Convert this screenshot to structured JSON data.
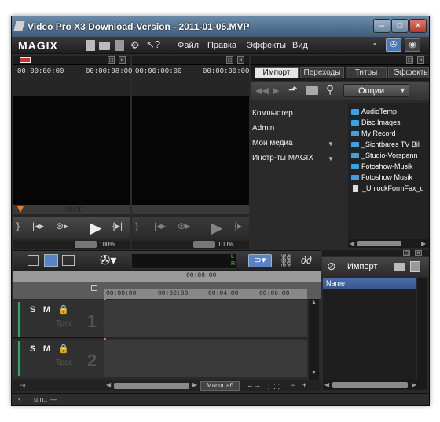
{
  "window": {
    "title": "Video Pro X3 Download-Version - 2011-01-05.MVP"
  },
  "menubar": {
    "logo": "MAGIX",
    "items": [
      "Файл",
      "Правка",
      "Эффекты",
      "Вид"
    ]
  },
  "monitor_left": {
    "timecode_left": "00:00:00:00",
    "timecode_right": "00:00:08:00",
    "timeline_mark": "08:00",
    "zoom": "100%"
  },
  "monitor_right": {
    "timecode_left": "00:00:00:00",
    "timecode_right": "00:00:00:00",
    "zoom": "100%"
  },
  "media_pool": {
    "tabs": [
      "Импорт",
      "Переходы",
      "Титры",
      "Эффекты"
    ],
    "options_label": "Опции",
    "tree": [
      "Компьютер",
      "Admin",
      "Мои медиа",
      "Инстр-ты MAGIX"
    ],
    "files": [
      {
        "name": "AudioTemp",
        "type": "folder"
      },
      {
        "name": "Disc Images",
        "type": "folder"
      },
      {
        "name": "My Record",
        "type": "folder"
      },
      {
        "name": "_Sichtbares TV Bil",
        "type": "folder"
      },
      {
        "name": "_Studio-Vorspann",
        "type": "folder"
      },
      {
        "name": "Fotoshow-Musik",
        "type": "folder"
      },
      {
        "name": "Fotoshow Musik",
        "type": "folder"
      },
      {
        "name": "_UnlockFormFax_d",
        "type": "file"
      }
    ]
  },
  "timeline": {
    "position": "00:08:00",
    "ruler": [
      "00:00:00",
      "00:02:00",
      "00:04:00",
      "00:06:00"
    ],
    "tracks": [
      {
        "number": "1",
        "label": "Трек",
        "s": "S",
        "m": "M"
      },
      {
        "number": "2",
        "label": "Трек",
        "s": "S",
        "m": "M"
      }
    ],
    "zoom_label": "Масштаб",
    "meter": [
      "L",
      "R"
    ]
  },
  "import_panel": {
    "title": "Импорт",
    "column": "Name"
  },
  "status": {
    "text": "u.n.: —"
  }
}
